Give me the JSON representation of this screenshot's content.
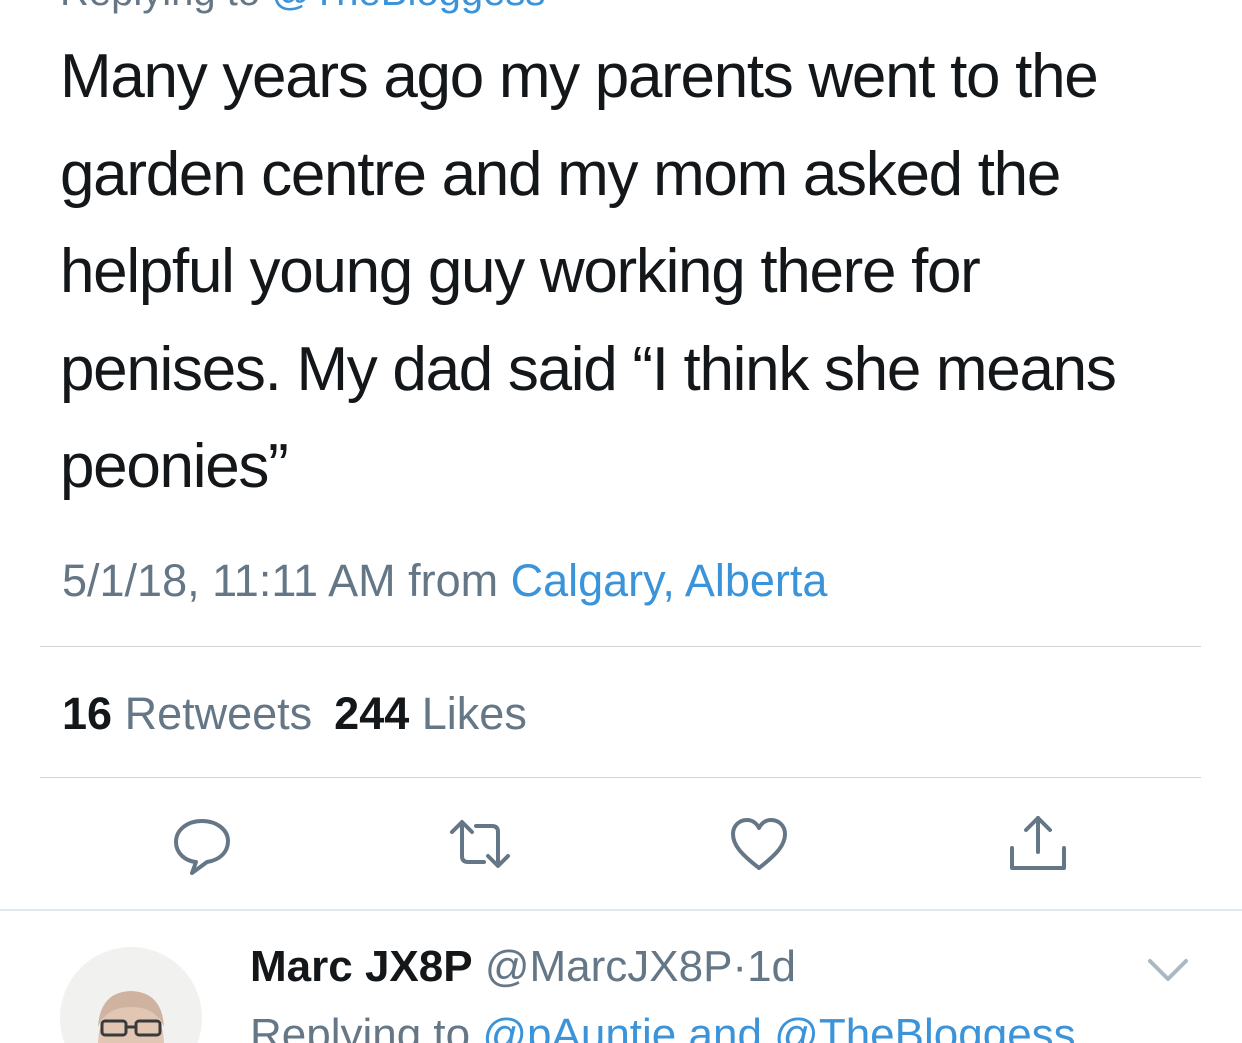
{
  "tweet": {
    "replying_prefix": "Replying to",
    "replying_handle": "@TheBloggess",
    "text": "Many years ago my parents went to the garden centre and my mom asked the helpful young guy working there for penises. My dad said “I think she means peonies”",
    "timestamp": "5/1/18, 11:11 AM",
    "from_label": "from",
    "location": "Calgary, Alberta"
  },
  "stats": {
    "retweets_count": "16",
    "retweets_label": "Retweets",
    "likes_count": "244",
    "likes_label": "Likes"
  },
  "actions": {
    "icons": [
      "reply-icon",
      "retweet-icon",
      "like-icon",
      "share-icon"
    ]
  },
  "reply": {
    "name": "Marc JX8P",
    "handle": "@MarcJX8P",
    "separator": "·",
    "time": "1d",
    "replying_prefix": "Replying to",
    "replying_handle_1": "@pAuntie",
    "replying_conjunction": "and",
    "replying_handle_2": "@TheBloggess"
  },
  "colors": {
    "text": "#14171a",
    "secondary": "#657786",
    "link": "#3b94d9",
    "divider": "#cfd4d9"
  }
}
